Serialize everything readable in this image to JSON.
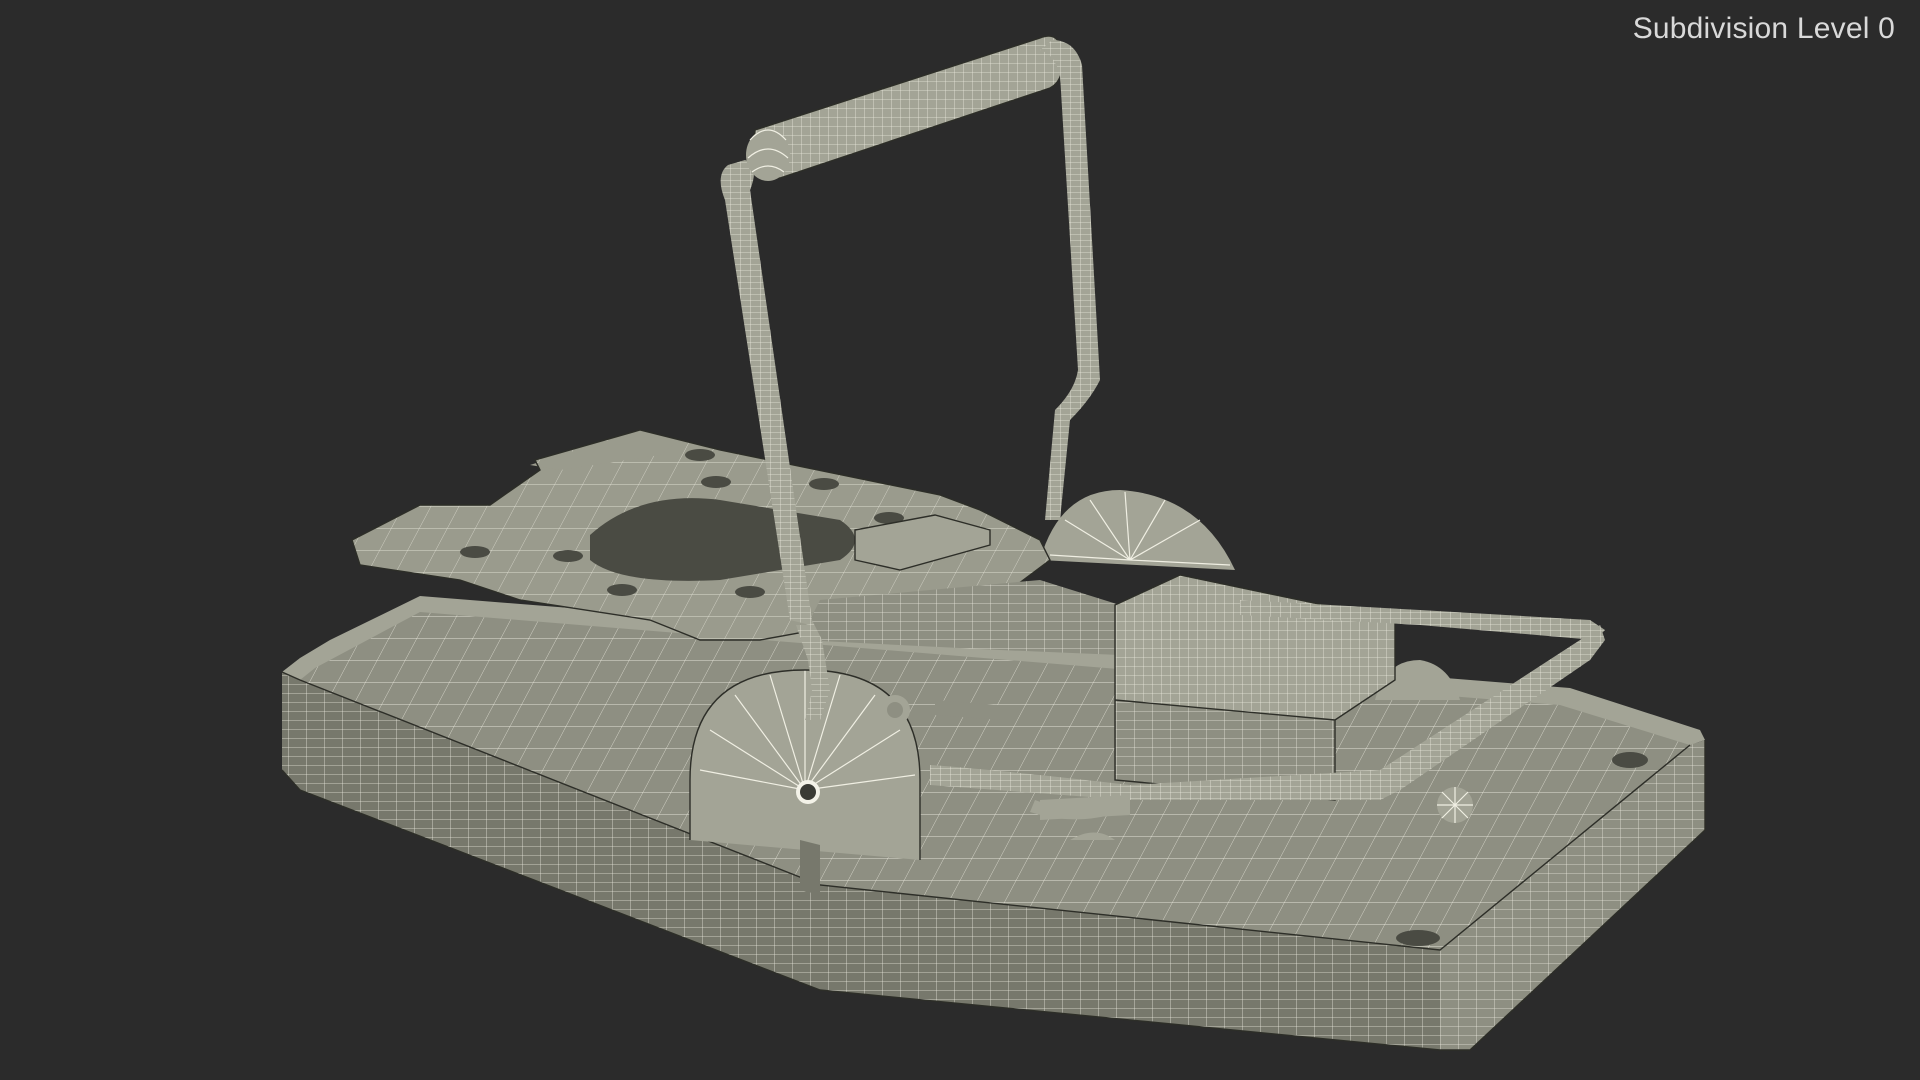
{
  "overlay": {
    "label": "Subdivision Level 0"
  },
  "colors": {
    "background": "#2b2b2b",
    "model_surface": "#8e8f82",
    "wireframe": "#f0efe3",
    "label_text": "#d9d9d9"
  },
  "scene": {
    "subject": "mouse-trap-wireframe-model"
  }
}
